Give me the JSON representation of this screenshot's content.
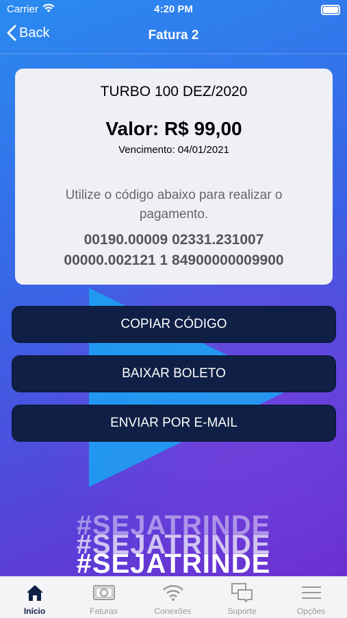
{
  "status_bar": {
    "carrier": "Carrier",
    "time": "4:20 PM"
  },
  "nav": {
    "back_label": "Back",
    "title": "Fatura 2"
  },
  "invoice": {
    "plan": "TURBO 100 DEZ/2020",
    "amount": "Valor: R$ 99,00",
    "due": "Vencimento: 04/01/2021",
    "instruction": "Utilize o código abaixo para realizar o pagamento.",
    "code_line1": "00190.00009 02331.231007",
    "code_line2": "00000.002121 1 84900000009900"
  },
  "actions": {
    "copy": "COPIAR CÓDIGO",
    "download": "BAIXAR BOLETO",
    "email": "ENVIAR POR E-MAIL"
  },
  "tagline": "#SEJATRINDE",
  "tabs": [
    {
      "label": "Início",
      "icon": "home-icon"
    },
    {
      "label": "Faturas",
      "icon": "bill-icon"
    },
    {
      "label": "Conexões",
      "icon": "wifi-icon"
    },
    {
      "label": "Suporte",
      "icon": "chat-icon"
    },
    {
      "label": "Opções",
      "icon": "menu-icon"
    }
  ],
  "colors": {
    "button": "#0f1f45",
    "active_tab": "#0f1f45",
    "inactive_tab": "#999999",
    "card": "#eef0f6"
  }
}
